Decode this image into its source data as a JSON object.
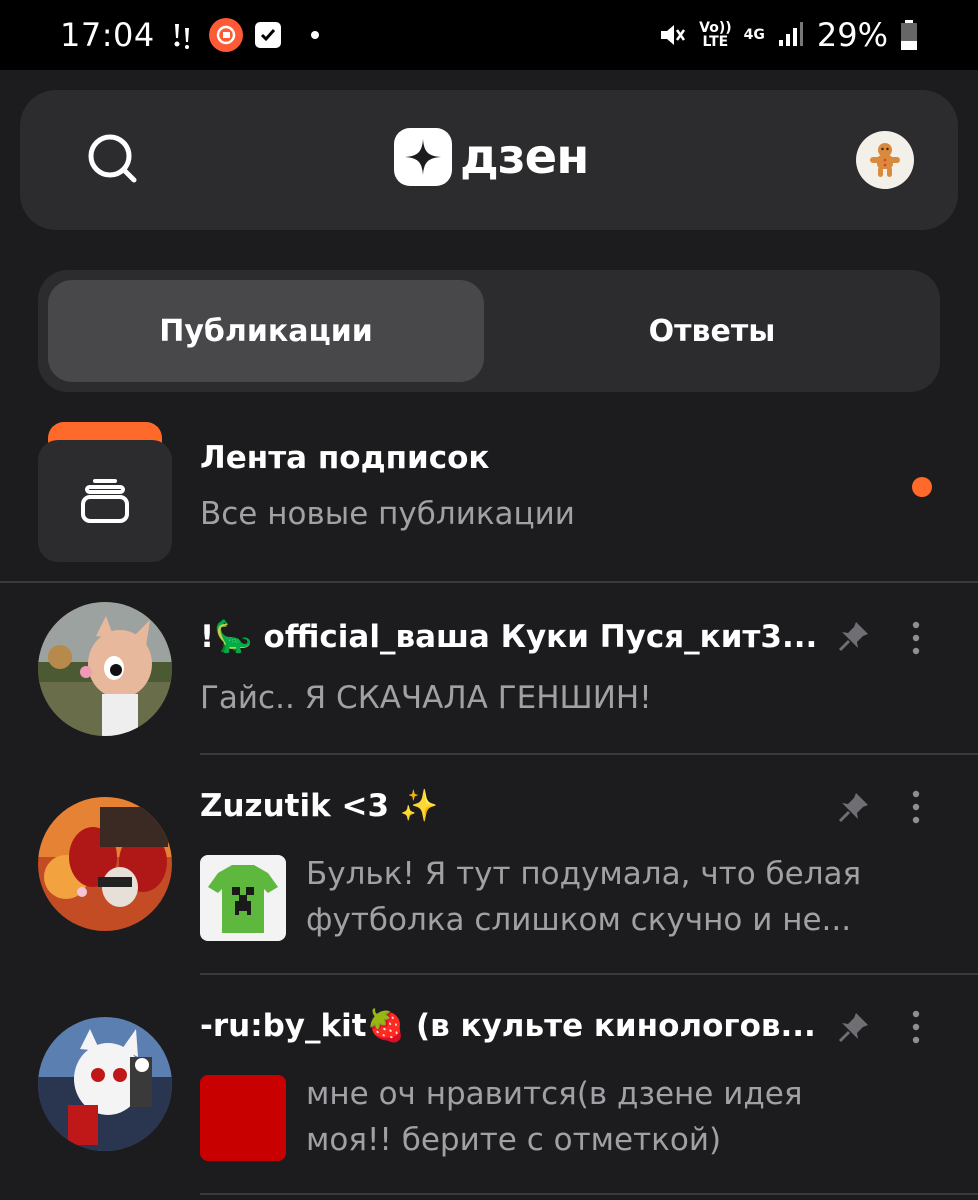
{
  "status_bar": {
    "time": "17:04",
    "battery": "29%",
    "volte": "Vo))\nLTE",
    "network": "4G"
  },
  "header": {
    "logo_text": "дзен"
  },
  "tabs": [
    {
      "label": "Публикации",
      "active": true
    },
    {
      "label": "Ответы",
      "active": false
    }
  ],
  "subscriptions": {
    "title": "Лента подписок",
    "subtitle": "Все новые публикации"
  },
  "chats": [
    {
      "name": "!🦕 official_ваша Куки Пуся_кит3...",
      "message": "Гайс.. Я СКАЧАЛА ГЕНШИН!"
    },
    {
      "name": "Zuzutik <3 ✨",
      "message_line1": "Бульк! Я тут подумала, что белая",
      "message_line2": "футболка слишком скучно и не..."
    },
    {
      "name": "-ru:by_kit🍓 (в культе кинологов...",
      "message_line1": "мне оч нравится(в дзене идея",
      "message_line2": "моя!! берите с отметкой)"
    }
  ],
  "colors": {
    "accent": "#ff6a2a",
    "background": "#1c1c1e",
    "card": "#2c2c2e"
  }
}
